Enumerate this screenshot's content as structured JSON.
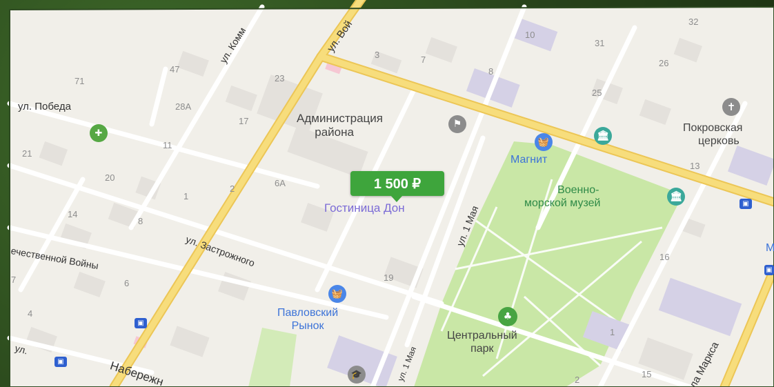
{
  "colors": {
    "road_major": "#f5d66a",
    "road_minor": "#ffffff",
    "park": "#c8e6a8",
    "building": "#e4e1dc",
    "background": "#f1efe9",
    "price_tag": "#3ea53c",
    "poi_blue": "#3c73d8",
    "poi_green": "#2e8a47"
  },
  "price_tag": "1 500 ₽",
  "selected_poi": "Гостиница Дон",
  "pois": {
    "admin_line1": "Администрация",
    "admin_line2": "района",
    "magnit": "Магнит",
    "museum_line1": "Военно-",
    "museum_line2": "морской музей",
    "church_line1": "Покровская",
    "church_line2": "церковь",
    "market_line1": "Павловский",
    "market_line2": "Рынок",
    "park_line1": "Центральный",
    "park_line2": "парк",
    "partial_m": "М"
  },
  "streets": {
    "pobeda": "ул. Победа",
    "zastrozhnogo": "ул. Застрожного",
    "may1_a": "ул. 1 Мая",
    "may1_b": "ул. 1 Мая",
    "voy": "ул. Вой",
    "komm": "ул. Комм",
    "otech": "ечественной Войны",
    "naber": "Набережн",
    "ul_short": "ул.",
    "marksa": "ола Маркса"
  },
  "house_numbers": [
    "71",
    "47",
    "23",
    "3",
    "7",
    "10",
    "31",
    "32",
    "26",
    "8",
    "25",
    "28А",
    "17",
    "13",
    "21",
    "11",
    "20",
    "2",
    "6А",
    "1",
    "14",
    "8",
    "16",
    "19",
    "6",
    "7",
    "4",
    "1",
    "2",
    "15"
  ]
}
